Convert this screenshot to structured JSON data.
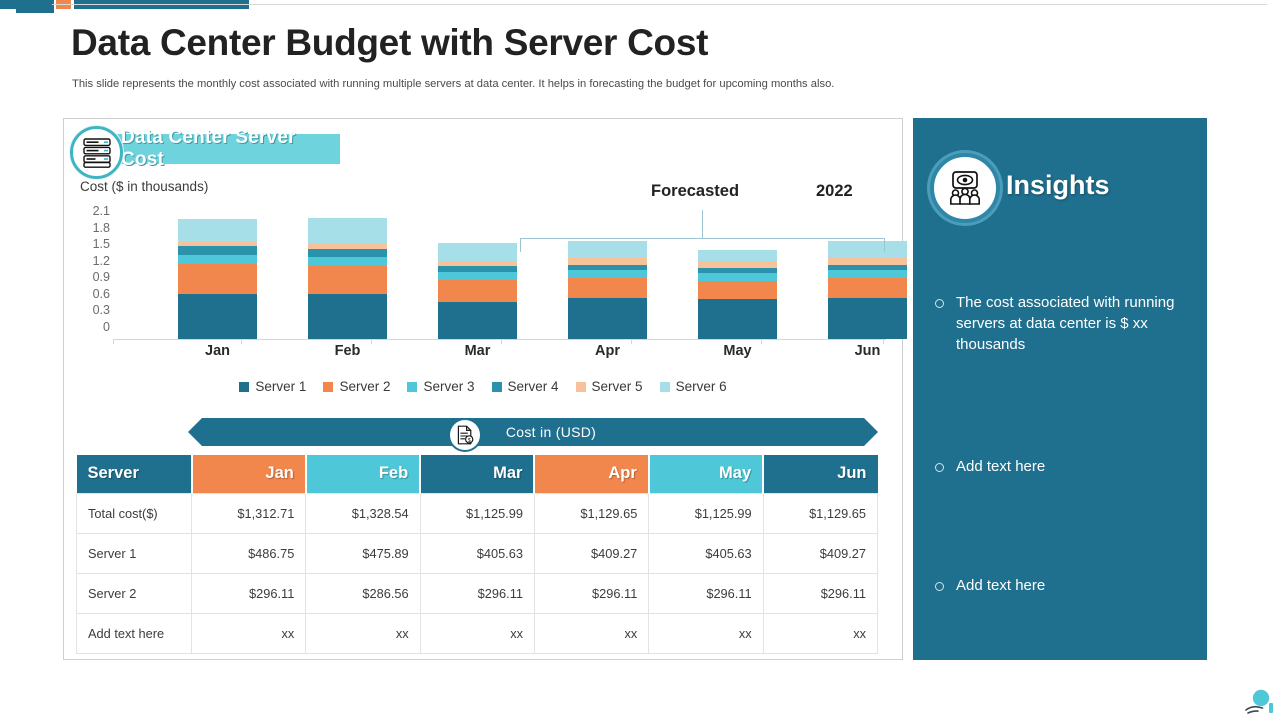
{
  "header": {
    "title": "Data Center Budget with Server Cost",
    "subtitle": "This slide represents the monthly cost associated with running multiple  servers at data center. It helps in  forecasting the budget for upcoming months also."
  },
  "chart_card": {
    "badge_label": "Data Center Server Cost",
    "badge_icon": "server-rack-icon"
  },
  "ribbon": {
    "label": "Cost  in (USD)",
    "icon": "document-dollar-icon"
  },
  "insights": {
    "title": "Insights",
    "icon": "presentation-audience-icon",
    "bullets": [
      "The cost associated with running  servers at data center is $ xx thousands",
      "Add text here",
      "Add text here"
    ]
  },
  "table": {
    "columns": [
      "Server",
      "Jan",
      "Feb",
      "Mar",
      "Apr",
      "May",
      "Jun"
    ],
    "header_colors": [
      "#1f6f8f",
      "#f2874d",
      "#4ec8d8",
      "#1f6f8f",
      "#f2874d",
      "#4ec8d8",
      "#1f6f8f"
    ],
    "rows": [
      {
        "label": "Total cost($)",
        "values": [
          "$1,312.71",
          "$1,328.54",
          "$1,125.99",
          "$1,129.65",
          "$1,125.99",
          "$1,129.65"
        ]
      },
      {
        "label": "Server 1",
        "values": [
          "$486.75",
          "$475.89",
          "$405.63",
          "$409.27",
          "$405.63",
          "$409.27"
        ]
      },
      {
        "label": "Server 2",
        "values": [
          "$296.11",
          "$286.56",
          "$296.11",
          "$296.11",
          "$296.11",
          "$296.11"
        ]
      },
      {
        "label": "Add text here",
        "values": [
          "xx",
          "xx",
          "xx",
          "xx",
          "xx",
          "xx"
        ]
      }
    ]
  },
  "chart_data": {
    "type": "bar",
    "title": "Data Center Server Cost",
    "subtype": "stacked",
    "xlabel": "",
    "ylabel": "Cost ($ in thousands)",
    "ylim": [
      0,
      2.1
    ],
    "yticks": [
      "2.1",
      "1.8",
      "1.5",
      "1.2",
      "0.9",
      "0.6",
      "0.3",
      "0"
    ],
    "grid": false,
    "legend_position": "bottom",
    "categories": [
      "Jan",
      "Feb",
      "Mar",
      "Apr",
      "May",
      "Jun"
    ],
    "series": [
      {
        "name": "Server 1",
        "color": "#1f6f8f",
        "values": [
          0.7,
          0.7,
          0.58,
          0.64,
          0.62,
          0.64
        ]
      },
      {
        "name": "Server 2",
        "color": "#f2874d",
        "values": [
          0.47,
          0.44,
          0.34,
          0.31,
          0.28,
          0.31
        ]
      },
      {
        "name": "Server 3",
        "color": "#4ec8d8",
        "values": [
          0.13,
          0.14,
          0.13,
          0.12,
          0.12,
          0.12
        ]
      },
      {
        "name": "Server 4",
        "color": "#2a93ab",
        "values": [
          0.14,
          0.12,
          0.08,
          0.08,
          0.09,
          0.08
        ]
      },
      {
        "name": "Server 5",
        "color": "#f7c29a",
        "values": [
          0.07,
          0.09,
          0.09,
          0.11,
          0.1,
          0.11
        ]
      },
      {
        "name": "Server 6",
        "color": "#a7dfe8",
        "values": [
          0.35,
          0.39,
          0.27,
          0.26,
          0.18,
          0.26
        ]
      }
    ],
    "annotations": [
      {
        "text": "Forecasted",
        "kind": "bracket-label"
      },
      {
        "text": "2022",
        "kind": "bracket-label"
      }
    ]
  },
  "theme": {
    "primary": "#1f6f8f",
    "accent_orange": "#f2874d",
    "accent_cyan": "#4ec8d8",
    "badge_cyan": "#6fd3dd"
  },
  "decor": {
    "corner_icon": "hand-holding-circle-icon"
  }
}
